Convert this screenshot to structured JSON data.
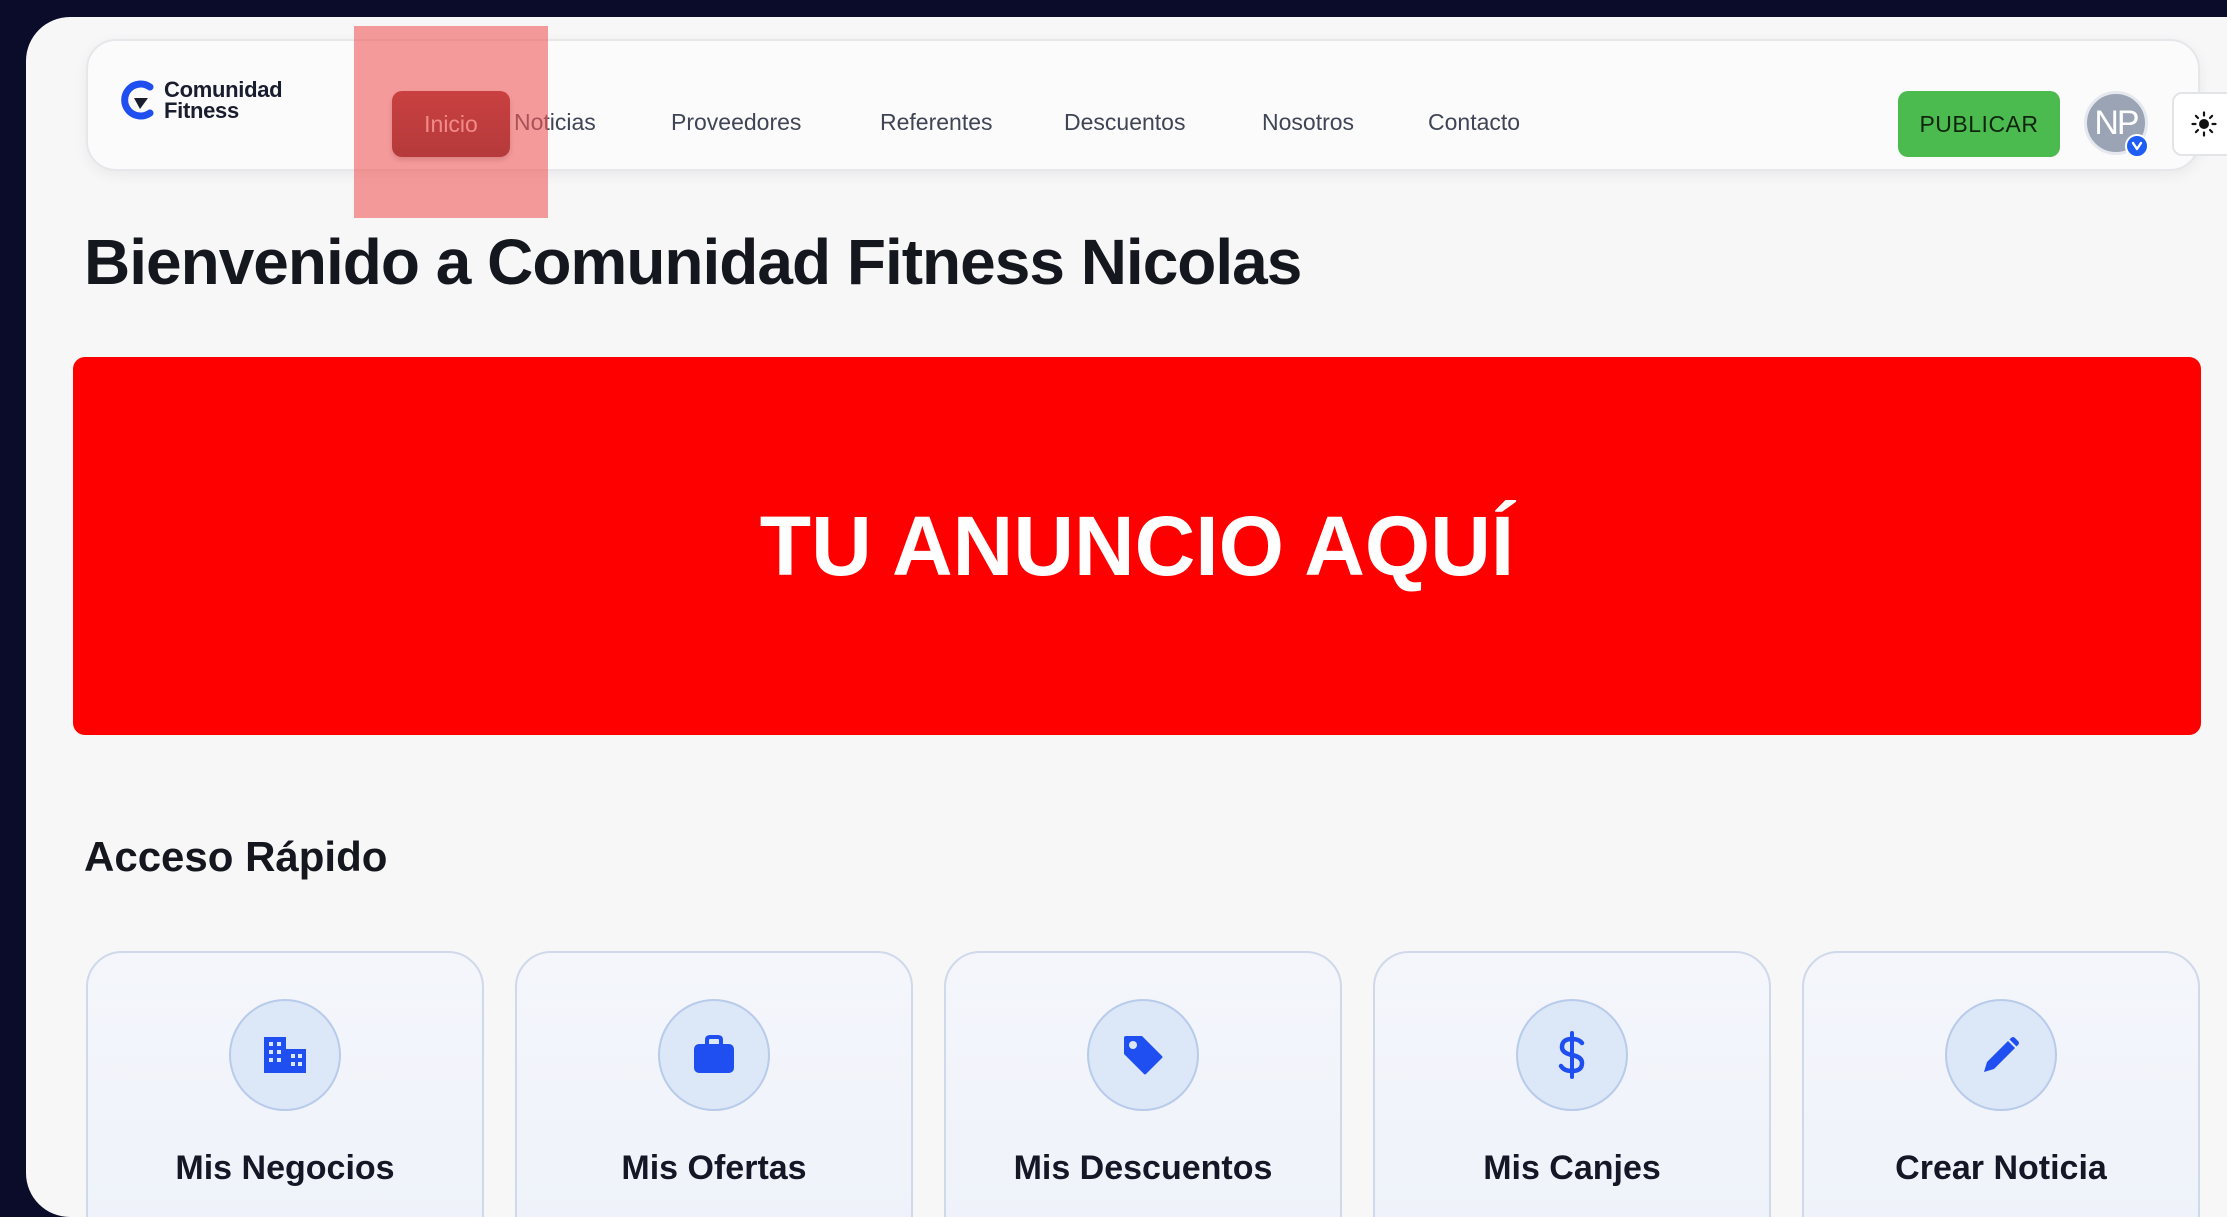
{
  "brand": {
    "line1": "Comunidad",
    "line2": "Fitness"
  },
  "nav": {
    "items": [
      "Inicio",
      "Noticias",
      "Proveedores",
      "Referentes",
      "Descuentos",
      "Nosotros",
      "Contacto"
    ],
    "active": "Inicio"
  },
  "actions": {
    "publish_label": "PUBLICAR",
    "avatar_initials": "NP",
    "avatar_badge_icon": "chevron-down-icon",
    "theme_icon": "sun-icon"
  },
  "welcome": "Bienvenido a Comunidad Fitness Nicolas",
  "ad_banner": "TU ANUNCIO AQUÍ",
  "quick_access": {
    "title": "Acceso Rápido",
    "cards": [
      {
        "label": "Mis Negocios",
        "icon": "building-icon"
      },
      {
        "label": "Mis Ofertas",
        "icon": "briefcase-icon"
      },
      {
        "label": "Mis Descuentos",
        "icon": "tag-icon"
      },
      {
        "label": "Mis Canjes",
        "icon": "dollar-icon"
      },
      {
        "label": "Crear Noticia",
        "icon": "pencil-icon"
      }
    ]
  },
  "colors": {
    "accent_blue": "#1f4ff0",
    "active_nav": "#7a1515",
    "publish_green": "#4cbb4f",
    "ad_red": "#ff0000"
  }
}
